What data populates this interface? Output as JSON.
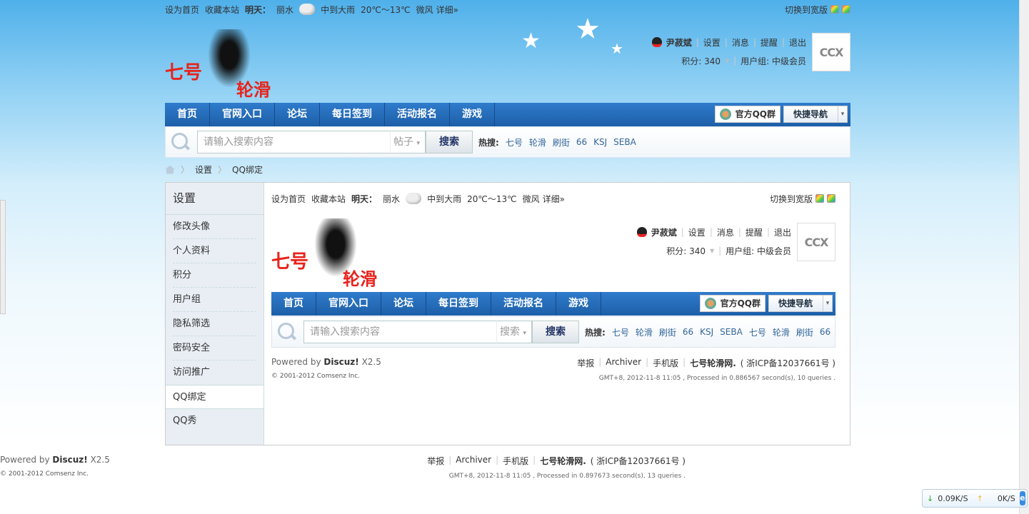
{
  "topbar": {
    "set_home": "设为首页",
    "bookmark": "收藏本站",
    "tomorrow_label": "明天：",
    "city": "丽水",
    "weather": "中到大雨",
    "temp": "20℃～13℃",
    "wind": "微风",
    "detail": "详细»",
    "switch_wide": "切换到宽版"
  },
  "logo": {
    "line1": "七号",
    "line2": "轮滑"
  },
  "user": {
    "name": "尹菽斌",
    "settings": "设置",
    "messages": "消息",
    "reminders": "提醒",
    "logout": "退出",
    "credits": "积分: 340",
    "group": "用户组: 中级会员",
    "avatar_text": "CCX"
  },
  "nav": {
    "items": [
      "首页",
      "官网入口",
      "论坛",
      "每日签到",
      "活动报名",
      "游戏"
    ],
    "qq_group": "官方QQ群",
    "quick_nav": "快捷导航"
  },
  "search": {
    "placeholder": "请输入搜索内容",
    "type": "帖子",
    "type_inner": "搜索",
    "button": "搜索",
    "hot_label": "热搜:",
    "hot": [
      "七号",
      "轮滑",
      "刷街",
      "66",
      "KSJ",
      "SEBA"
    ],
    "hot_inner": [
      "七号",
      "轮滑",
      "刷街",
      "66",
      "KSJ",
      "SEBA",
      "七号",
      "轮滑",
      "刷街",
      "66"
    ]
  },
  "breadcrumb": [
    "设置",
    "QQ绑定"
  ],
  "sidebar": {
    "title": "设置",
    "items": [
      "修改头像",
      "个人资料",
      "积分",
      "用户组",
      "隐私筛选",
      "密码安全",
      "访问推广",
      "QQ绑定",
      "QQ秀"
    ]
  },
  "footer": {
    "powered": "Powered by",
    "discuz": "Discuz!",
    "version": "X2.5",
    "copyright": "© 2001-2012 Comsenz Inc.",
    "report": "举报",
    "archiver": "Archiver",
    "mobile": "手机版",
    "site": "七号轮滑网.",
    "icp": "( 浙ICP备12037661号 )",
    "gmt_inner": "GMT+8, 2012-11-8 11:05 , Processed in 0.886567 second(s), 10 queries .",
    "gmt_outer": "GMT+8, 2012-11-8 11:05 , Processed in 0.897673 second(s), 13 queries ."
  },
  "netspeed": {
    "down": "0.09K/S",
    "up": "0K/S"
  }
}
